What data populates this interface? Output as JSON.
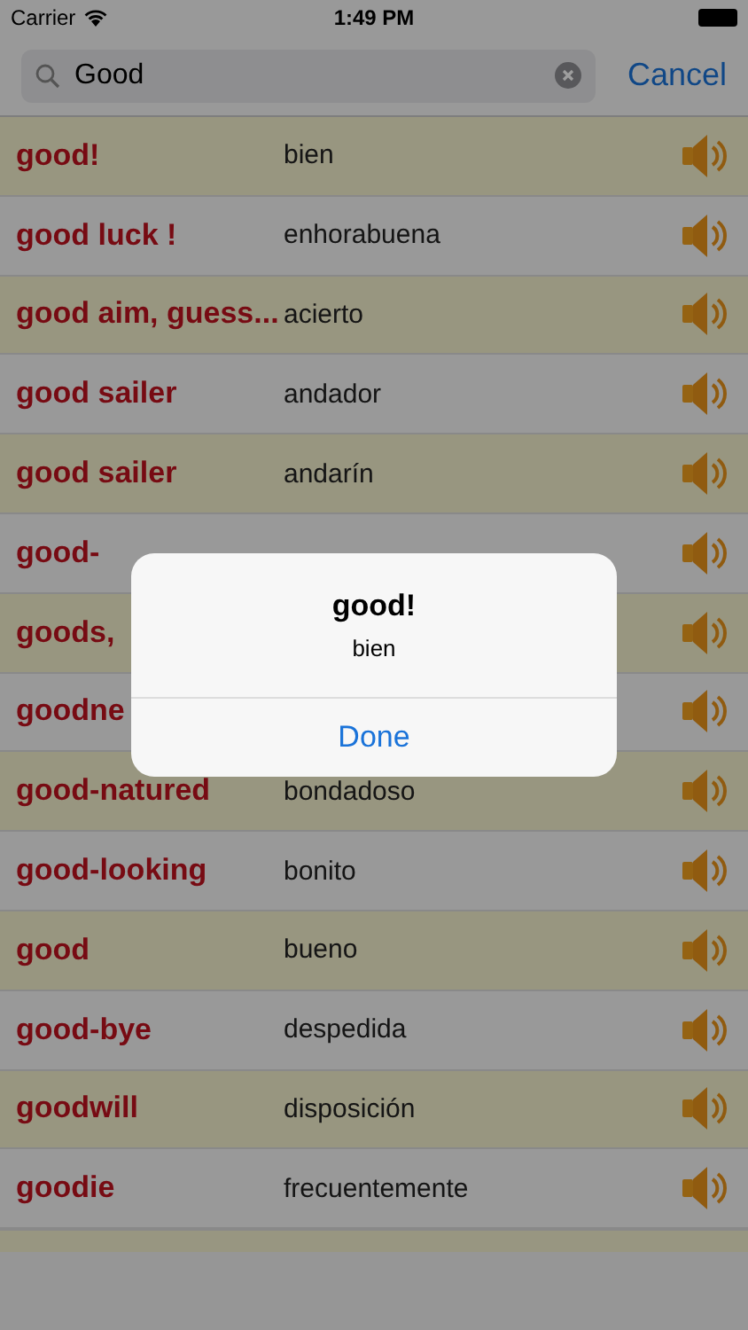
{
  "status_bar": {
    "carrier": "Carrier",
    "time": "1:49 PM"
  },
  "search": {
    "value": "Good",
    "cancel": "Cancel"
  },
  "rows": [
    {
      "word": "good!",
      "translation": "bien"
    },
    {
      "word": "good luck !",
      "translation": "enhorabuena"
    },
    {
      "word": "good aim, guess...",
      "translation": "acierto"
    },
    {
      "word": "good sailer",
      "translation": "andador"
    },
    {
      "word": "good sailer",
      "translation": "andarín"
    },
    {
      "word": "good-"
    },
    {
      "word": "goods,"
    },
    {
      "word": "goodne"
    },
    {
      "word": "good-natured",
      "translation": "bondadoso"
    },
    {
      "word": "good-looking",
      "translation": "bonito"
    },
    {
      "word": "good",
      "translation": "bueno"
    },
    {
      "word": "good-bye",
      "translation": "despedida"
    },
    {
      "word": "goodwill",
      "translation": "disposición"
    },
    {
      "word": "goodie",
      "translation": "frecuentemente"
    }
  ],
  "alert": {
    "title": "good!",
    "message": "bien",
    "button": "Done"
  }
}
